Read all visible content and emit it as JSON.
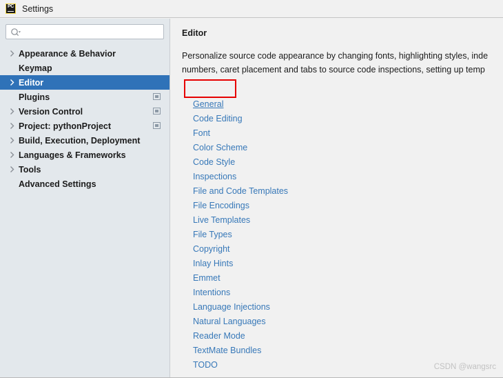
{
  "window": {
    "title": "Settings",
    "app_icon": "pycharm-icon",
    "app_icon_text": "PC"
  },
  "search": {
    "placeholder": "",
    "value": "",
    "icon": "search-icon"
  },
  "sidebar": {
    "items": [
      {
        "label": "Appearance & Behavior",
        "expandable": true,
        "selected": false,
        "scope_icon": false
      },
      {
        "label": "Keymap",
        "expandable": false,
        "selected": false,
        "scope_icon": false
      },
      {
        "label": "Editor",
        "expandable": true,
        "selected": true,
        "scope_icon": false
      },
      {
        "label": "Plugins",
        "expandable": false,
        "selected": false,
        "scope_icon": true
      },
      {
        "label": "Version Control",
        "expandable": true,
        "selected": false,
        "scope_icon": true
      },
      {
        "label": "Project: pythonProject",
        "expandable": true,
        "selected": false,
        "scope_icon": true
      },
      {
        "label": "Build, Execution, Deployment",
        "expandable": true,
        "selected": false,
        "scope_icon": false
      },
      {
        "label": "Languages & Frameworks",
        "expandable": true,
        "selected": false,
        "scope_icon": false
      },
      {
        "label": "Tools",
        "expandable": true,
        "selected": false,
        "scope_icon": false
      },
      {
        "label": "Advanced Settings",
        "expandable": false,
        "selected": false,
        "scope_icon": false
      }
    ]
  },
  "main": {
    "title": "Editor",
    "description_line1": "Personalize source code appearance by changing fonts, highlighting styles, inde",
    "description_line2": "numbers, caret placement and tabs to source code inspections, setting up temp",
    "links": [
      {
        "label": "General",
        "hovered": true
      },
      {
        "label": "Code Editing",
        "hovered": false
      },
      {
        "label": "Font",
        "hovered": false
      },
      {
        "label": "Color Scheme",
        "hovered": false
      },
      {
        "label": "Code Style",
        "hovered": false
      },
      {
        "label": "Inspections",
        "hovered": false
      },
      {
        "label": "File and Code Templates",
        "hovered": false
      },
      {
        "label": "File Encodings",
        "hovered": false
      },
      {
        "label": "Live Templates",
        "hovered": false
      },
      {
        "label": "File Types",
        "hovered": false
      },
      {
        "label": "Copyright",
        "hovered": false
      },
      {
        "label": "Inlay Hints",
        "hovered": false
      },
      {
        "label": "Emmet",
        "hovered": false
      },
      {
        "label": "Intentions",
        "hovered": false
      },
      {
        "label": "Language Injections",
        "hovered": false
      },
      {
        "label": "Natural Languages",
        "hovered": false
      },
      {
        "label": "Reader Mode",
        "hovered": false
      },
      {
        "label": "TextMate Bundles",
        "hovered": false
      },
      {
        "label": "TODO",
        "hovered": false
      }
    ]
  },
  "annotation": {
    "name": "general-highlight-box",
    "color": "#e60000"
  },
  "watermark": {
    "text": "CSDN @wangsrc"
  },
  "colors": {
    "selection_blue": "#2f72b8",
    "link_blue": "#3778b8",
    "sidebar_bg": "#e3e8ec",
    "content_bg": "#f1f1f1",
    "annotation_red": "#e60000"
  }
}
